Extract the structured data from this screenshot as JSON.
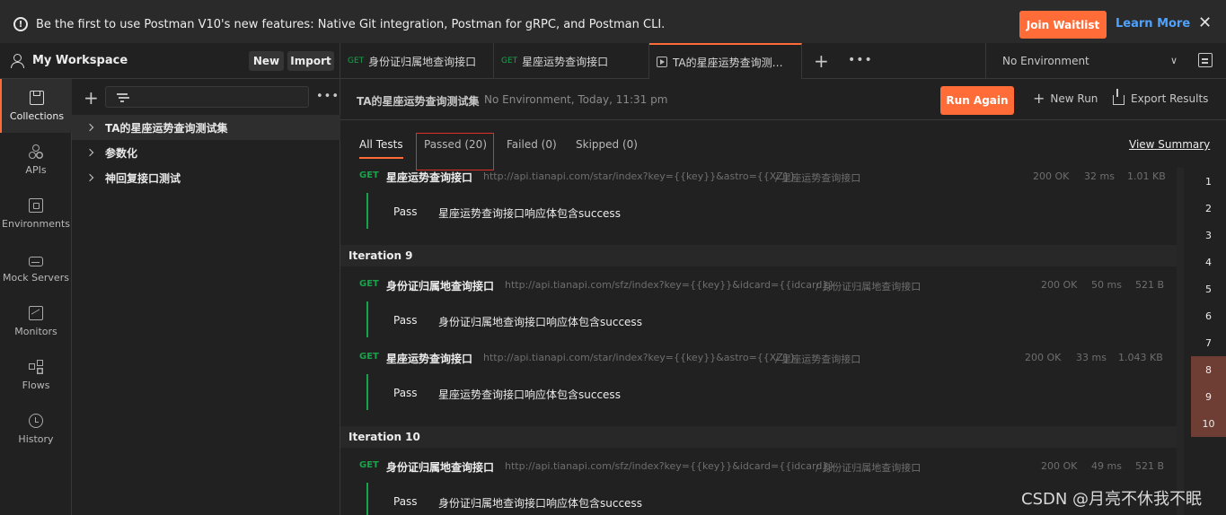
{
  "banner": {
    "message": "Be the first to use Postman V10's new features: Native Git integration, Postman for gRPC, and Postman CLI.",
    "join_label": "Join Waitlist",
    "learn_label": "Learn More"
  },
  "workspace": {
    "title": "My Workspace",
    "new_label": "New",
    "import_label": "Import"
  },
  "tabs": [
    {
      "method": "GET",
      "label": "身份证归属地查询接口"
    },
    {
      "method": "GET",
      "label": "星座运势查询接口"
    },
    {
      "method": "",
      "label": "TA的星座运势查询测试集"
    }
  ],
  "environment": {
    "selected": "No Environment"
  },
  "nav": [
    {
      "label": "Collections",
      "icon": "collections-icon"
    },
    {
      "label": "APIs",
      "icon": "apis-icon"
    },
    {
      "label": "Environments",
      "icon": "environments-icon"
    },
    {
      "label": "Mock Servers",
      "icon": "mock-servers-icon"
    },
    {
      "label": "Monitors",
      "icon": "monitors-icon"
    },
    {
      "label": "Flows",
      "icon": "flows-icon"
    },
    {
      "label": "History",
      "icon": "history-icon"
    }
  ],
  "collections": [
    {
      "label": "TA的星座运势查询测试集"
    },
    {
      "label": "参数化"
    },
    {
      "label": "神回复接口测试"
    }
  ],
  "run": {
    "title": "TA的星座运势查询测试集",
    "meta": "No Environment, Today, 11:31 pm",
    "run_again": "Run Again",
    "new_run": "New Run",
    "export": "Export Results"
  },
  "filters": {
    "all": "All Tests",
    "passed": "Passed (20)",
    "failed": "Failed (0)",
    "skipped": "Skipped (0)",
    "summary": "View Summary"
  },
  "results": {
    "req1": {
      "method": "GET",
      "name": "星座运势查询接口",
      "url": "http://api.tianapi.com/star/index?key={{key}}&astro={{XZ}}",
      "path": "/ 星座运势查询接口",
      "status": "200 OK",
      "time": "32 ms",
      "size": "1.01 KB"
    },
    "test1": {
      "result": "Pass",
      "name": "星座运势查询接口响应体包含success"
    },
    "iter9": "Iteration 9",
    "req2": {
      "method": "GET",
      "name": "身份证归属地查询接口",
      "url": "http://api.tianapi.com/sfz/index?key={{key}}&idcard={{idcard}}",
      "path": "/ 身份证归属地查询接口",
      "status": "200 OK",
      "time": "50 ms",
      "size": "521 B"
    },
    "test2": {
      "result": "Pass",
      "name": "身份证归属地查询接口响应体包含success"
    },
    "req3": {
      "method": "GET",
      "name": "星座运势查询接口",
      "url": "http://api.tianapi.com/star/index?key={{key}}&astro={{XZ}}",
      "path": "/ 星座运势查询接口",
      "status": "200 OK",
      "time": "33 ms",
      "size": "1.043 KB"
    },
    "test3": {
      "result": "Pass",
      "name": "星座运势查询接口响应体包含success"
    },
    "iter10": "Iteration 10",
    "req4": {
      "method": "GET",
      "name": "身份证归属地查询接口",
      "url": "http://api.tianapi.com/sfz/index?key={{key}}&idcard={{idcard}}",
      "path": "/ 身份证归属地查询接口",
      "status": "200 OK",
      "time": "49 ms",
      "size": "521 B"
    },
    "test4": {
      "result": "Pass",
      "name": "身份证归属地查询接口响应体包含success"
    }
  },
  "iterations": [
    "1",
    "2",
    "3",
    "4",
    "5",
    "6",
    "7",
    "8",
    "9",
    "10"
  ],
  "watermark": "CSDN @月亮不休我不眠",
  "colors": {
    "accent": "#ff6c37",
    "get": "#17a34a",
    "link": "#4da3ff",
    "highlight_box": "#e0302a"
  }
}
